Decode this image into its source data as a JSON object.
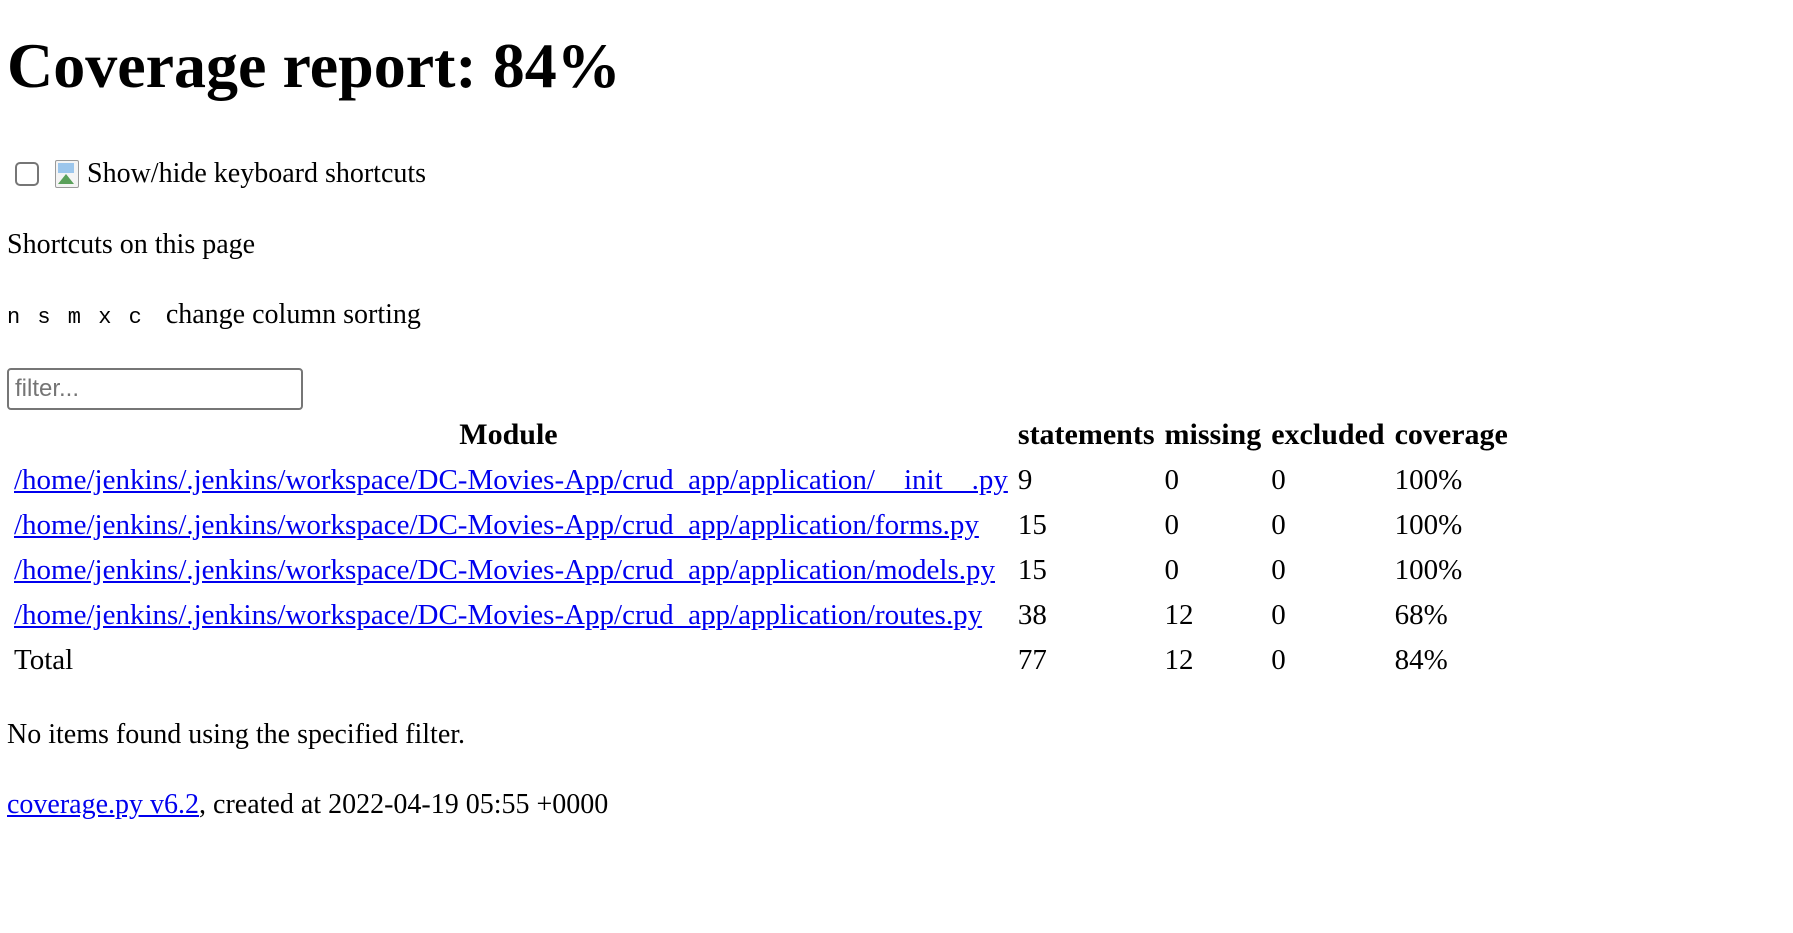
{
  "header": {
    "title": "Coverage report: 84%"
  },
  "keyboard_toggle": {
    "label": "Show/hide keyboard shortcuts",
    "icon": "broken-image-icon"
  },
  "shortcuts": {
    "title": "Shortcuts on this page",
    "keys": "n s m x c",
    "description": "change column sorting"
  },
  "filter": {
    "placeholder": "filter...",
    "value": ""
  },
  "table": {
    "headers": {
      "module": "Module",
      "statements": "statements",
      "missing": "missing",
      "excluded": "excluded",
      "coverage": "coverage"
    },
    "rows": [
      {
        "name": "/home/jenkins/.jenkins/workspace/DC-Movies-App/crud_app/application/__init__.py",
        "statements": "9",
        "missing": "0",
        "excluded": "0",
        "coverage": "100%"
      },
      {
        "name": "/home/jenkins/.jenkins/workspace/DC-Movies-App/crud_app/application/forms.py",
        "statements": "15",
        "missing": "0",
        "excluded": "0",
        "coverage": "100%"
      },
      {
        "name": "/home/jenkins/.jenkins/workspace/DC-Movies-App/crud_app/application/models.py",
        "statements": "15",
        "missing": "0",
        "excluded": "0",
        "coverage": "100%"
      },
      {
        "name": "/home/jenkins/.jenkins/workspace/DC-Movies-App/crud_app/application/routes.py",
        "statements": "38",
        "missing": "12",
        "excluded": "0",
        "coverage": "68%"
      }
    ],
    "total": {
      "name": "Total",
      "statements": "77",
      "missing": "12",
      "excluded": "0",
      "coverage": "84%"
    }
  },
  "empty_message": "No items found using the specified filter.",
  "footer": {
    "link_text": "coverage.py v6.2",
    "suffix": ", created at 2022-04-19 05:55 +0000"
  }
}
